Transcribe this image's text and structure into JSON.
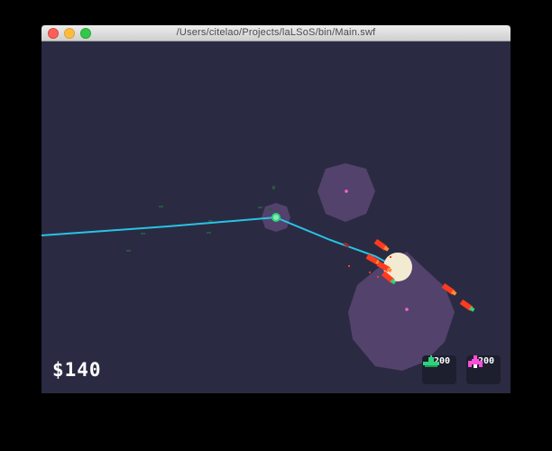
{
  "window": {
    "title": "/Users/citelao/Projects/laLSoS/bin/Main.swf"
  },
  "hud": {
    "money": "$140"
  },
  "shop": [
    {
      "price": "$200",
      "unit_icon": "green-tank-icon",
      "color": "#2fd27a"
    },
    {
      "price": "$200",
      "unit_icon": "pink-fighter-icon",
      "color": "#ff4fd8"
    }
  ],
  "colors": {
    "background": "#2a2b42",
    "laser": "#29c3e6",
    "zone": "#5a4672",
    "enemy": "#ff3b1f",
    "core": "#f3ead2"
  }
}
